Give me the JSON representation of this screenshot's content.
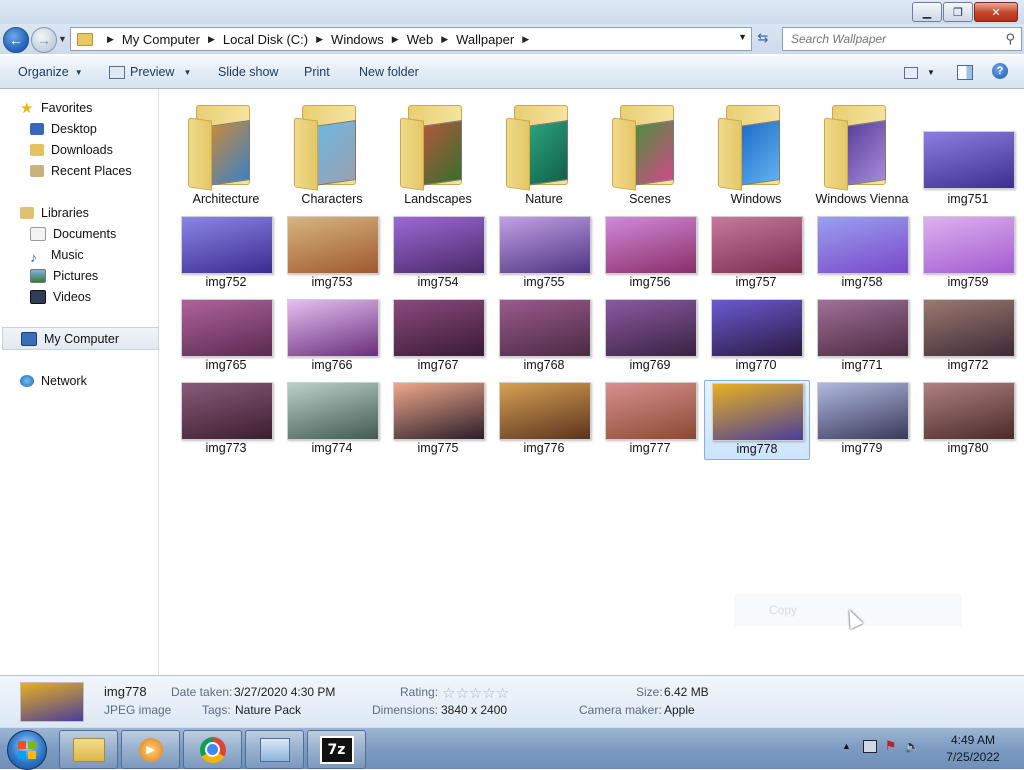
{
  "window": {
    "minimize_glyph": "▁",
    "maximize_glyph": "❐",
    "close_glyph": "✕"
  },
  "address": {
    "crumbs": [
      "My Computer",
      "Local Disk (C:)",
      "Windows",
      "Web",
      "Wallpaper"
    ],
    "search_placeholder": "Search Wallpaper"
  },
  "toolbar": {
    "organize": "Organize",
    "preview": "Preview",
    "slideshow": "Slide show",
    "print": "Print",
    "new_folder": "New folder"
  },
  "nav": {
    "favorites": "Favorites",
    "desktop": "Desktop",
    "downloads": "Downloads",
    "recent": "Recent Places",
    "libraries": "Libraries",
    "documents": "Documents",
    "music": "Music",
    "pictures": "Pictures",
    "videos": "Videos",
    "computer": "My Computer",
    "network": "Network"
  },
  "items": [
    {
      "name": "Architecture",
      "kind": "folder",
      "colors": [
        "#c88a3c",
        "#3b82c4"
      ]
    },
    {
      "name": "Characters",
      "kind": "folder",
      "colors": [
        "#6fb7e0",
        "#9aa0b0"
      ]
    },
    {
      "name": "Landscapes",
      "kind": "folder",
      "colors": [
        "#b0583a",
        "#3a6e2e"
      ]
    },
    {
      "name": "Nature",
      "kind": "folder",
      "colors": [
        "#2aa37c",
        "#12614a"
      ]
    },
    {
      "name": "Scenes",
      "kind": "folder",
      "colors": [
        "#4c8f3a",
        "#d04a8a"
      ]
    },
    {
      "name": "Windows",
      "kind": "folder",
      "colors": [
        "#1e6cc8",
        "#5fb2f0"
      ]
    },
    {
      "name": "Windows Vienna",
      "kind": "folder",
      "colors": [
        "#5a3f9a",
        "#a48ad8"
      ]
    },
    {
      "name": "img751",
      "kind": "image",
      "colors": [
        "#8a7ee0",
        "#3d2f8f"
      ]
    },
    {
      "name": "img752",
      "kind": "image",
      "colors": [
        "#8a86e6",
        "#3b2a90"
      ]
    },
    {
      "name": "img753",
      "kind": "image",
      "colors": [
        "#d6b680",
        "#a0582e"
      ]
    },
    {
      "name": "img754",
      "kind": "image",
      "colors": [
        "#9b6ad6",
        "#4a2868"
      ]
    },
    {
      "name": "img755",
      "kind": "image",
      "colors": [
        "#c1a0e6",
        "#4d3480"
      ]
    },
    {
      "name": "img756",
      "kind": "image",
      "colors": [
        "#d08ad8",
        "#8a2e6a"
      ]
    },
    {
      "name": "img757",
      "kind": "image",
      "colors": [
        "#c7789e",
        "#7a2e4e"
      ]
    },
    {
      "name": "img758",
      "kind": "image",
      "colors": [
        "#9aa0f0",
        "#7a48c8"
      ]
    },
    {
      "name": "img759",
      "kind": "image",
      "colors": [
        "#e0b0f0",
        "#a05cd0"
      ]
    },
    {
      "name": "img765",
      "kind": "image",
      "colors": [
        "#b0629a",
        "#5a2a52"
      ]
    },
    {
      "name": "img766",
      "kind": "image",
      "colors": [
        "#e4c0f2",
        "#6a2e7a"
      ]
    },
    {
      "name": "img767",
      "kind": "image",
      "colors": [
        "#8a4a7e",
        "#3a1a36"
      ]
    },
    {
      "name": "img768",
      "kind": "image",
      "colors": [
        "#9a5a8e",
        "#4a2a42"
      ]
    },
    {
      "name": "img769",
      "kind": "image",
      "colors": [
        "#8a5aa0",
        "#3a2244"
      ]
    },
    {
      "name": "img770",
      "kind": "image",
      "colors": [
        "#6a5ad0",
        "#2a1a40"
      ]
    },
    {
      "name": "img771",
      "kind": "image",
      "colors": [
        "#a07098",
        "#4a2a40"
      ]
    },
    {
      "name": "img772",
      "kind": "image",
      "colors": [
        "#9a7a70",
        "#3e2a36"
      ]
    },
    {
      "name": "img773",
      "kind": "image",
      "colors": [
        "#8a5a78",
        "#3a1e30"
      ]
    },
    {
      "name": "img774",
      "kind": "image",
      "colors": [
        "#bcd0c8",
        "#405a52"
      ]
    },
    {
      "name": "img775",
      "kind": "image",
      "colors": [
        "#f0a88a",
        "#2a1e2a"
      ]
    },
    {
      "name": "img776",
      "kind": "image",
      "colors": [
        "#d8a050",
        "#5a3420"
      ]
    },
    {
      "name": "img777",
      "kind": "image",
      "colors": [
        "#d89090",
        "#8a4a30"
      ]
    },
    {
      "name": "img778",
      "kind": "image",
      "colors": [
        "#e8b020",
        "#4a3e9a"
      ]
    },
    {
      "name": "img779",
      "kind": "image",
      "colors": [
        "#b0b8e0",
        "#3a3a5a"
      ]
    },
    {
      "name": "img780",
      "kind": "image",
      "colors": [
        "#b08080",
        "#4a2a2a"
      ]
    }
  ],
  "selected_item": "img778",
  "ghost_menu": {
    "copy": "Copy"
  },
  "details": {
    "name": "img778",
    "type": "JPEG image",
    "date_taken_label": "Date taken:",
    "date_taken": "3/27/2020 4:30 PM",
    "tags_label": "Tags:",
    "tags": "Nature Pack",
    "rating_label": "Rating:",
    "rating": 0,
    "dimensions_label": "Dimensions:",
    "dimensions": "3840 x 2400",
    "size_label": "Size:",
    "size": "6.42 MB",
    "camera_label": "Camera maker:",
    "camera": "Apple",
    "thumb_colors": [
      "#e8b020",
      "#4a3e9a"
    ]
  },
  "taskbar": {
    "apps": [
      "explorer-icon",
      "media-player-icon",
      "chrome-icon",
      "control-panel-icon",
      "7zip-icon"
    ],
    "sevenzip_label": "7z",
    "time": "4:49 AM",
    "date": "7/25/2022",
    "tray_glyphs": {
      "arrow": "▲",
      "flag": "⚑",
      "speaker": "🔈"
    }
  },
  "colors": {
    "accent": "#1f5fb7",
    "selection": "#cde4fb",
    "close": "#c4432a"
  }
}
